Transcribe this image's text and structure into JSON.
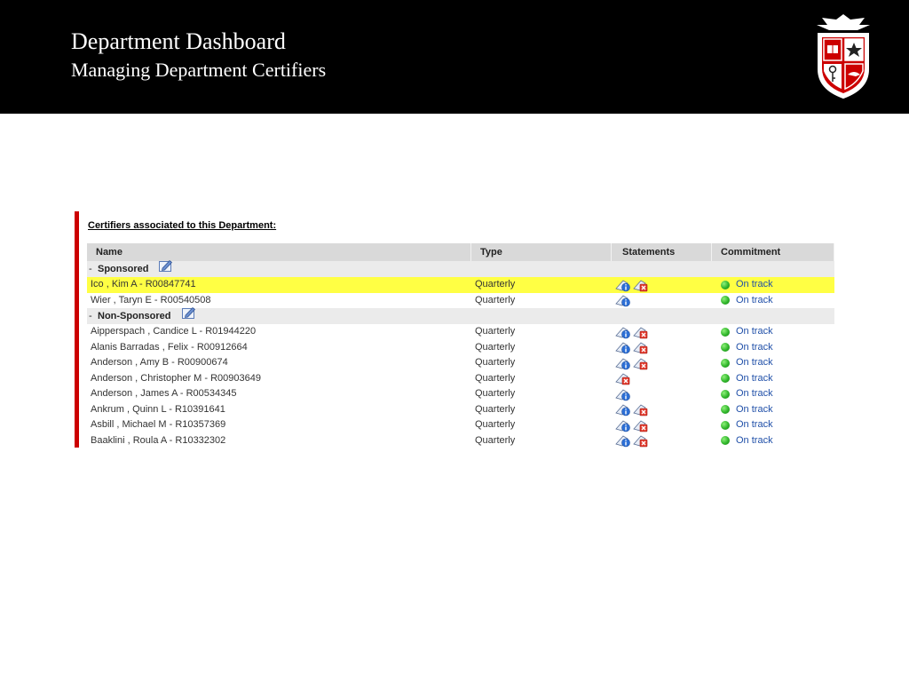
{
  "header": {
    "title": "Department Dashboard",
    "subtitle": "Managing Department Certifiers",
    "logo_icon": "university-seal-icon"
  },
  "colors": {
    "banner": "#000000",
    "accent": "#cc0000",
    "highlight": "#ffff44",
    "status_green": "#2fb52a",
    "link_blue": "#1f4fa8"
  },
  "panel": {
    "heading": "Certifiers associated to this Department:",
    "columns": {
      "name": "Name",
      "type": "Type",
      "statements": "Statements",
      "commitment": "Commitment"
    },
    "groups": [
      {
        "toggle": "-",
        "label": "Sponsored",
        "rows": [
          {
            "name": "Ico , Kim A - R00847741",
            "type": "Quarterly",
            "statements": [
              "info-statement-icon",
              "delete-statement-icon"
            ],
            "commitment": "On track",
            "highlighted": true
          },
          {
            "name": "Wier , Taryn E - R00540508",
            "type": "Quarterly",
            "statements": [
              "info-statement-icon"
            ],
            "commitment": "On track",
            "highlighted": false
          }
        ]
      },
      {
        "toggle": "-",
        "label": "Non-Sponsored",
        "rows": [
          {
            "name": "Aipperspach , Candice L - R01944220",
            "type": "Quarterly",
            "statements": [
              "info-statement-icon",
              "delete-statement-icon"
            ],
            "commitment": "On track",
            "highlighted": false
          },
          {
            "name": "Alanis Barradas , Felix - R00912664",
            "type": "Quarterly",
            "statements": [
              "info-statement-icon",
              "delete-statement-icon"
            ],
            "commitment": "On track",
            "highlighted": false
          },
          {
            "name": "Anderson , Amy B - R00900674",
            "type": "Quarterly",
            "statements": [
              "info-statement-icon",
              "delete-statement-icon"
            ],
            "commitment": "On track",
            "highlighted": false
          },
          {
            "name": "Anderson , Christopher M - R00903649",
            "type": "Quarterly",
            "statements": [
              "delete-statement-icon"
            ],
            "commitment": "On track",
            "highlighted": false
          },
          {
            "name": "Anderson , James A - R00534345",
            "type": "Quarterly",
            "statements": [
              "info-statement-icon"
            ],
            "commitment": "On track",
            "highlighted": false
          },
          {
            "name": "Ankrum , Quinn L - R10391641",
            "type": "Quarterly",
            "statements": [
              "info-statement-icon",
              "delete-statement-icon"
            ],
            "commitment": "On track",
            "highlighted": false
          },
          {
            "name": "Asbill , Michael M - R10357369",
            "type": "Quarterly",
            "statements": [
              "info-statement-icon",
              "delete-statement-icon"
            ],
            "commitment": "On track",
            "highlighted": false
          },
          {
            "name": "Baaklini , Roula A - R10332302",
            "type": "Quarterly",
            "statements": [
              "info-statement-icon",
              "delete-statement-icon"
            ],
            "commitment": "On track",
            "highlighted": false
          }
        ]
      }
    ]
  }
}
